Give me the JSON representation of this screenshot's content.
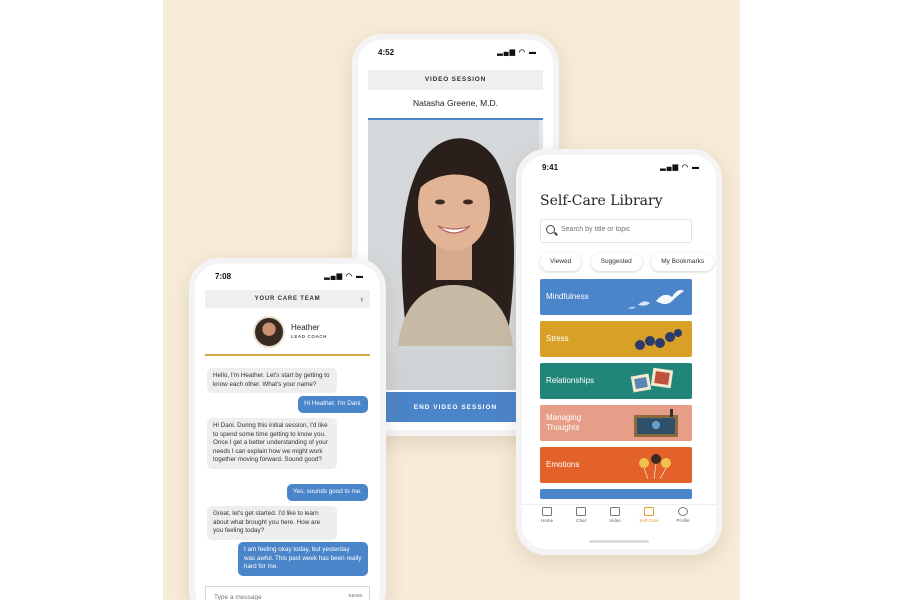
{
  "colors": {
    "background": "#f7ecd8",
    "accent_blue": "#4a84c9",
    "accent_gold": "#d8a73a"
  },
  "video_phone": {
    "time": "4:52",
    "header": "VIDEO SESSION",
    "provider_name": "Natasha Greene, M.D.",
    "end_button": "END VIDEO SESSION"
  },
  "chat_phone": {
    "time": "7:08",
    "header": "YOUR CARE TEAM",
    "coach_name": "Heather",
    "coach_role": "LEAD COACH",
    "messages": [
      {
        "from": "coach",
        "text": "Hello, I'm Heather. Let's start by getting to know each other. What's your name?"
      },
      {
        "from": "user",
        "text": "Hi Heather. I'm Dani."
      },
      {
        "from": "coach",
        "text": "Hi Dani. During this initial session, I'd like to spend some time getting to know you. Once I get a better understanding of your needs I can explain how we might work together moving forward. Sound good?"
      },
      {
        "from": "user",
        "text": "Yes, sounds good to me."
      },
      {
        "from": "coach",
        "text": "Great, let's get started. I'd like to learn about what brought you here. How are you feeling today?"
      },
      {
        "from": "user",
        "text": "I am feeling okay today, but yesterday was awful. This past week has been really hard for me."
      }
    ],
    "input_placeholder": "Type a message",
    "send_label": "SEND"
  },
  "library_phone": {
    "time": "9:41",
    "title": "Self-Care Library",
    "search_placeholder": "Search by title or topic",
    "filters": [
      "Viewed",
      "Suggested",
      "My Bookmarks"
    ],
    "cards": [
      {
        "label": "Mindfulness",
        "color": "#4a84c9"
      },
      {
        "label": "Stress",
        "color": "#d9a028"
      },
      {
        "label": "Relationships",
        "color": "#21857a"
      },
      {
        "label": "Managing Thoughts",
        "color": "#e79e88"
      },
      {
        "label": "Emotions",
        "color": "#e2622a"
      }
    ],
    "tabs": [
      {
        "label": "Home",
        "icon": "home-icon"
      },
      {
        "label": "Chat",
        "icon": "chat-icon"
      },
      {
        "label": "Video",
        "icon": "video-icon"
      },
      {
        "label": "Self-Care",
        "icon": "book-icon"
      },
      {
        "label": "Profile",
        "icon": "profile-icon"
      }
    ],
    "active_tab": "Self-Care"
  }
}
